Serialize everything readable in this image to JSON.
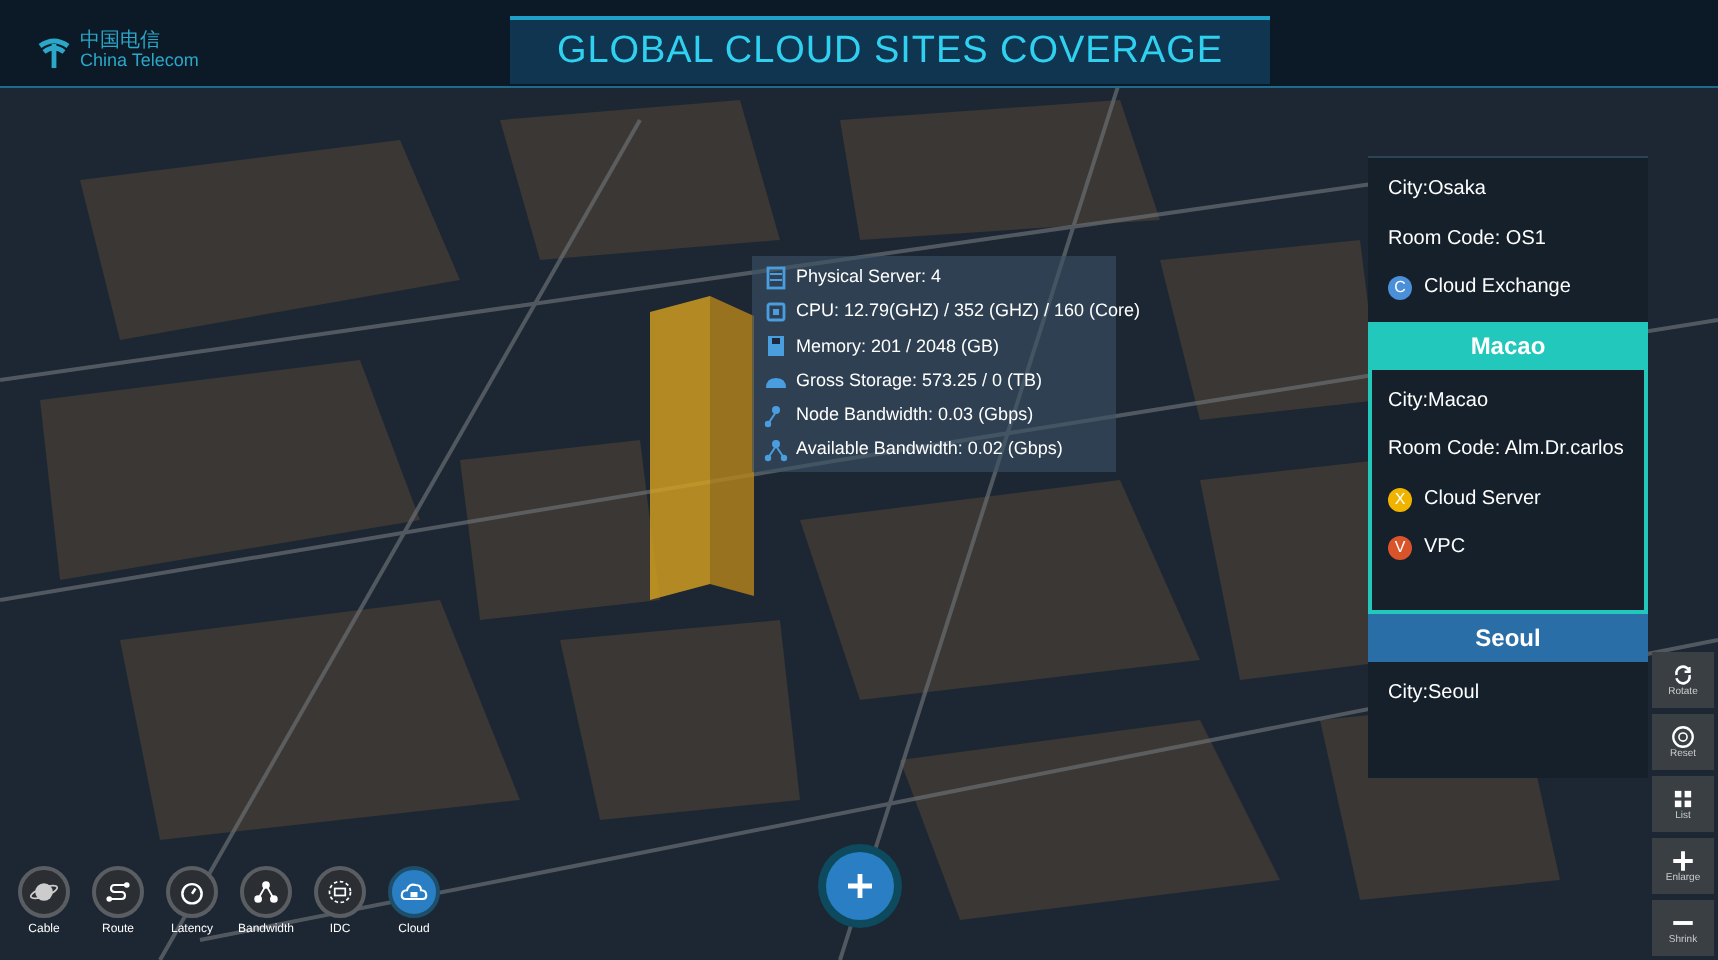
{
  "header": {
    "logo_cn": "中国电信",
    "logo_en": "China Telecom",
    "title": "GLOBAL CLOUD SITES COVERAGE"
  },
  "site_info": [
    {
      "kind": "server",
      "text": "Physical Server: 4"
    },
    {
      "kind": "cpu",
      "text": "CPU: 12.79(GHZ) / 352 (GHZ) / 160 (Core)"
    },
    {
      "kind": "memory",
      "text": "Memory: 201 / 2048 (GB)"
    },
    {
      "kind": "storage",
      "text": "Gross Storage: 573.25 / 0 (TB)"
    },
    {
      "kind": "node",
      "text": "Node Bandwidth: 0.03 (Gbps)"
    },
    {
      "kind": "available",
      "text": "Available Bandwidth: 0.02 (Gbps)"
    }
  ],
  "sites": [
    {
      "city": "City:Osaka",
      "room": "Room Code: OS1",
      "services": [
        {
          "badge": "C",
          "label": "Cloud Exchange",
          "color": "#4a8fd8"
        }
      ]
    },
    {
      "title": "Macao",
      "selected": true,
      "city": "City:Macao",
      "room": "Room Code: Alm.Dr.carlos",
      "services": [
        {
          "badge": "X",
          "label": "Cloud Server",
          "color": "#f0b400"
        },
        {
          "badge": "V",
          "label": "VPC",
          "color": "#d9542b"
        }
      ]
    },
    {
      "title": "Seoul",
      "selected": false,
      "city": "City:Seoul"
    }
  ],
  "tools": [
    {
      "kind": "rotate",
      "label": "Rotate"
    },
    {
      "kind": "reset",
      "label": "Reset"
    },
    {
      "kind": "list",
      "label": "List"
    },
    {
      "kind": "enlarge",
      "label": "Enlarge"
    },
    {
      "kind": "shrink",
      "label": "Shrink"
    }
  ],
  "layers": [
    {
      "kind": "cable",
      "label": "Cable",
      "selected": false
    },
    {
      "kind": "route",
      "label": "Route",
      "selected": false
    },
    {
      "kind": "latency",
      "label": "Latency",
      "selected": false
    },
    {
      "kind": "bandwidth",
      "label": "Bandwidth",
      "selected": false
    },
    {
      "kind": "idc",
      "label": "IDC",
      "selected": false
    },
    {
      "kind": "cloud",
      "label": "Cloud",
      "selected": true
    }
  ]
}
